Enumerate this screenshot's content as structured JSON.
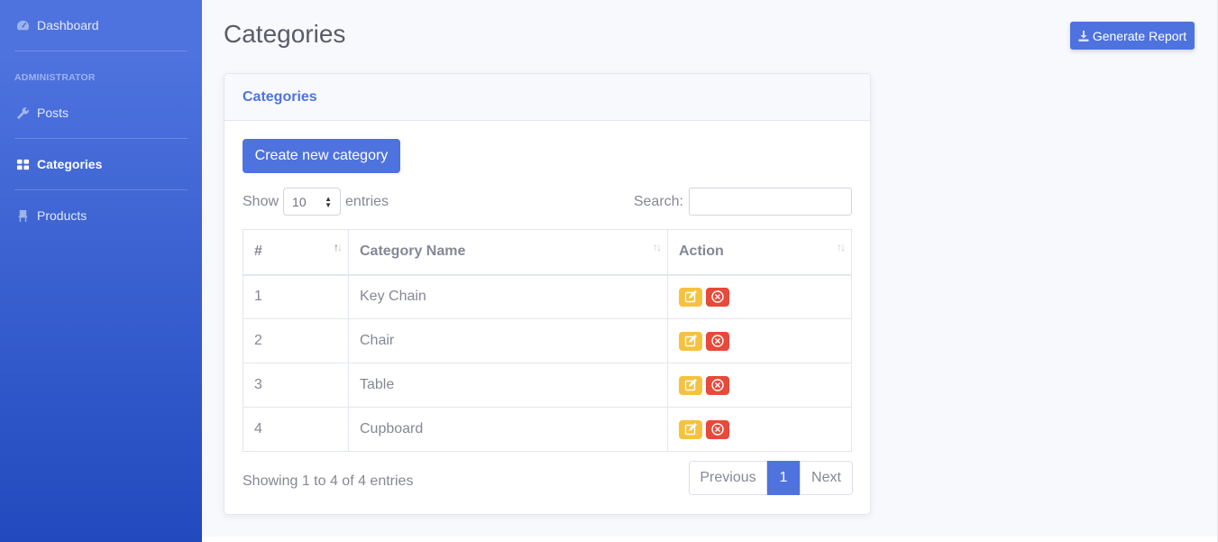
{
  "sidebar": {
    "dashboard": {
      "label": "Dashboard",
      "icon": "tachometer-icon"
    },
    "heading": "Administrator",
    "items": [
      {
        "label": "Posts",
        "icon": "wrench-icon"
      },
      {
        "label": "Categories",
        "icon": "grid-icon",
        "active": true
      },
      {
        "label": "Products",
        "icon": "chair-icon"
      }
    ]
  },
  "header": {
    "title": "Categories",
    "report_button": "Generate Report"
  },
  "card": {
    "title": "Categories",
    "create_button": "Create new category",
    "length": {
      "prefix": "Show",
      "value": "10",
      "suffix": "entries"
    },
    "search_label": "Search:",
    "search_value": "",
    "columns": [
      "#",
      "Category Name",
      "Action"
    ],
    "rows": [
      {
        "id": "1",
        "name": "Key Chain"
      },
      {
        "id": "2",
        "name": "Chair"
      },
      {
        "id": "3",
        "name": "Table"
      },
      {
        "id": "4",
        "name": "Cupboard"
      }
    ],
    "info": "Showing 1 to 4 of 4 entries",
    "pagination": {
      "previous": "Previous",
      "current": "1",
      "next": "Next"
    }
  },
  "colors": {
    "primary": "#4e73df",
    "warning": "#f6c23e",
    "danger": "#e74a3b"
  }
}
